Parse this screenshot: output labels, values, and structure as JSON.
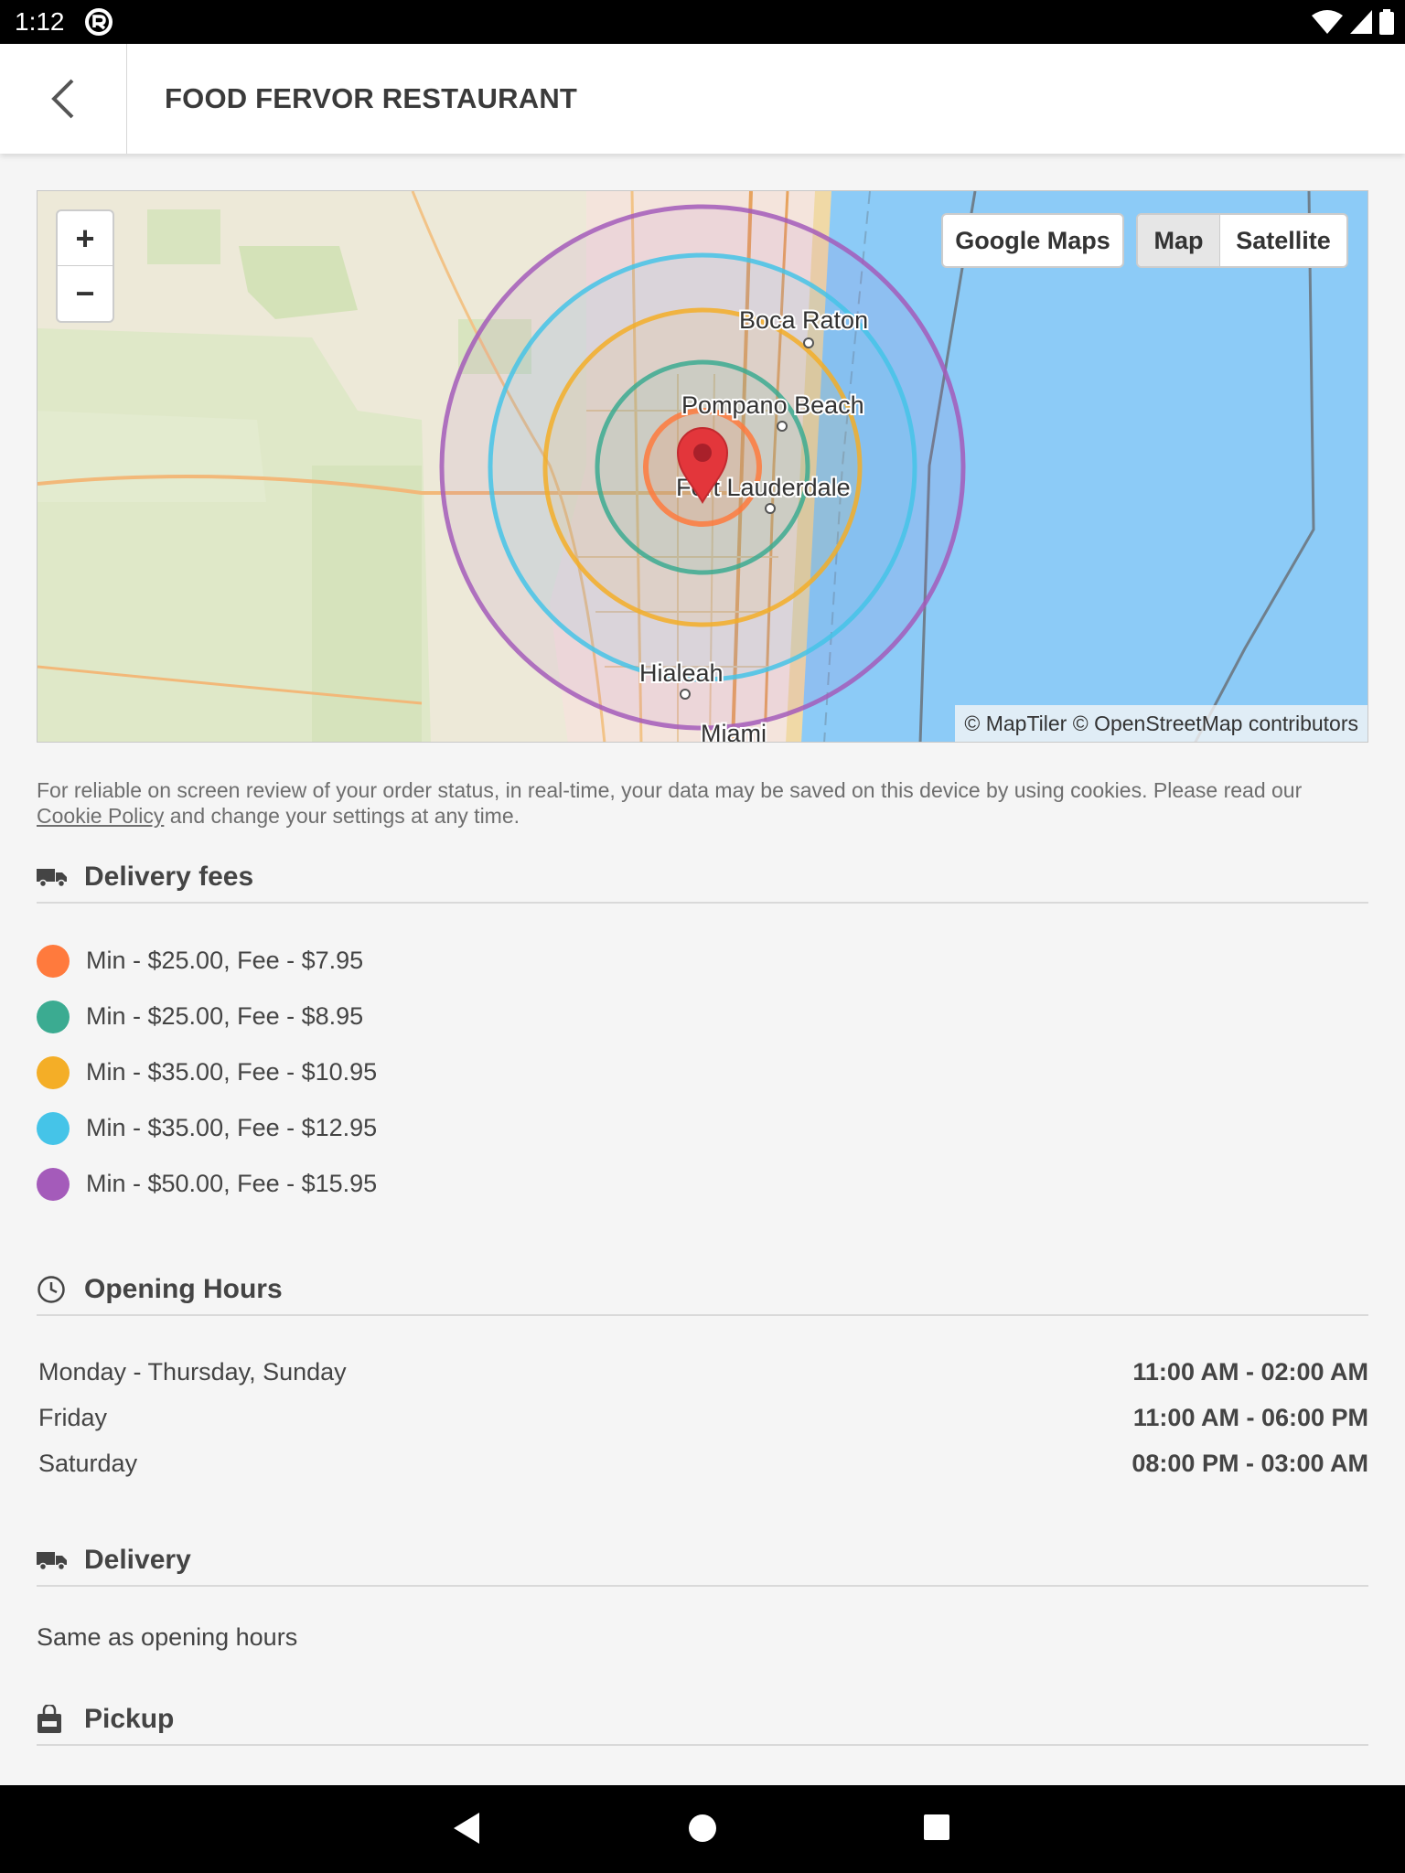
{
  "status_bar": {
    "time": "1:12"
  },
  "header": {
    "title": "FOOD FERVOR RESTAURANT",
    "back_icon": "chevron-left-icon"
  },
  "map": {
    "zoom_in": "+",
    "zoom_out": "−",
    "google_maps": "Google Maps",
    "map_type": "Map",
    "satellite_type": "Satellite",
    "attribution": "© MapTiler © OpenStreetMap contributors",
    "cities": [
      "Boca Raton",
      "Pompano Beach",
      "Fort Lauderdale",
      "Hialeah",
      "Miami"
    ]
  },
  "cookie": {
    "text": "For reliable on screen review of your order status, in real-time, your data may be saved on this device by using cookies. Please read our",
    "link": "Cookie Policy",
    "after": "and change your settings at any time."
  },
  "delivery_fees": {
    "title": "Delivery fees",
    "items": [
      {
        "label": "Min - $25.00, Fee - $7.95",
        "color": "#ff7a3d"
      },
      {
        "label": "Min - $25.00, Fee - $8.95",
        "color": "#3bab91"
      },
      {
        "label": "Min - $35.00, Fee - $10.95",
        "color": "#f4ae27"
      },
      {
        "label": "Min - $35.00, Fee - $12.95",
        "color": "#45c4e8"
      },
      {
        "label": "Min - $50.00, Fee - $15.95",
        "color": "#a45bba"
      }
    ]
  },
  "opening_hours": {
    "title": "Opening Hours",
    "rows": [
      {
        "day": "Monday - Thursday, Sunday",
        "time": "11:00 AM - 02:00 AM"
      },
      {
        "day": "Friday",
        "time": "11:00 AM - 06:00 PM"
      },
      {
        "day": "Saturday",
        "time": "08:00 PM - 03:00 AM"
      }
    ]
  },
  "delivery": {
    "title": "Delivery",
    "text": "Same as opening hours"
  },
  "pickup": {
    "title": "Pickup"
  }
}
